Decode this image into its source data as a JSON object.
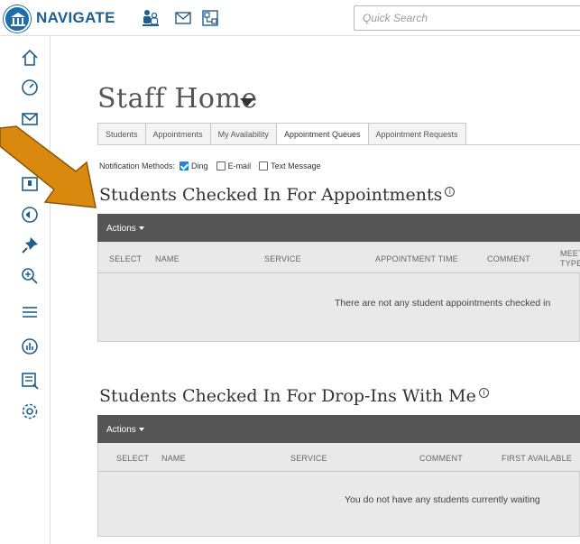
{
  "brand": "NAVIGATE",
  "search": {
    "placeholder": "Quick Search"
  },
  "topbar_icons": [
    "people-icon",
    "mail-icon",
    "org-chart-icon"
  ],
  "sidebar_icons": [
    "home-icon",
    "dashboard-icon",
    "mail-icon",
    "calendar-icon",
    "appointment-icon",
    "megaphone-icon",
    "pin-icon",
    "search-plus-icon",
    "list-icon",
    "reports-icon",
    "kiosk-icon",
    "settings-icon"
  ],
  "page": {
    "title": "Staff Home"
  },
  "tabs": [
    {
      "label": "Students",
      "active": false
    },
    {
      "label": "Appointments",
      "active": false
    },
    {
      "label": "My Availability",
      "active": false
    },
    {
      "label": "Appointment Queues",
      "active": true
    },
    {
      "label": "Appointment Requests",
      "active": false
    }
  ],
  "notifications": {
    "label": "Notification Methods:",
    "options": [
      {
        "label": "Ding",
        "checked": true
      },
      {
        "label": "E-mail",
        "checked": false
      },
      {
        "label": "Text Message",
        "checked": false
      }
    ]
  },
  "appointments_section": {
    "title": "Students Checked In For Appointments",
    "info": "i",
    "actions_label": "Actions",
    "columns": [
      "SELECT",
      "NAME",
      "SERVICE",
      "APPOINTMENT TIME",
      "COMMENT",
      "MEET",
      "TYPE"
    ],
    "empty_message": "There are not any student appointments checked in"
  },
  "dropins_section": {
    "title": "Students Checked In For Drop-Ins With Me",
    "info": "i",
    "actions_label": "Actions",
    "columns": [
      "SELECT",
      "NAME",
      "SERVICE",
      "COMMENT",
      "FIRST AVAILABLE"
    ],
    "empty_message": "You do not have any students currently waiting"
  },
  "colors": {
    "brand": "#1e5f8f",
    "actions_bar": "#555555",
    "arrow": "#d98a0e",
    "checkbox_checked": "#1d86d8"
  }
}
